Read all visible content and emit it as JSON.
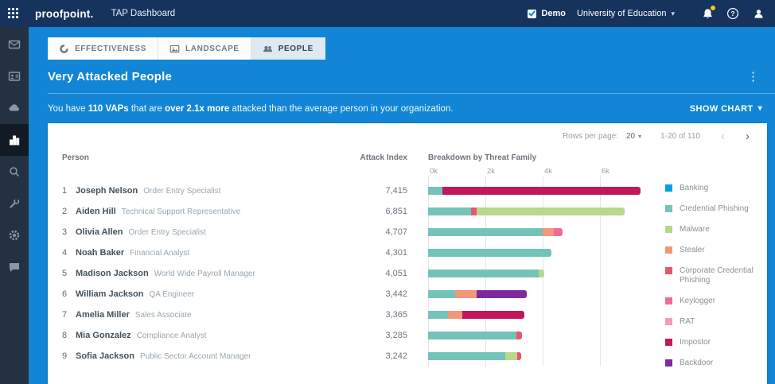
{
  "topbar": {
    "logo": "proofpoint.",
    "app_title": "TAP Dashboard",
    "demo_label": "Demo",
    "org_name": "University of Education"
  },
  "sidebar": {
    "items": [
      "mail",
      "contacts",
      "cloud",
      "analytics",
      "search",
      "tools",
      "settings",
      "chat"
    ],
    "active_item": "analytics"
  },
  "tabs": [
    {
      "label": "EFFECTIVENESS"
    },
    {
      "label": "LANDSCAPE"
    },
    {
      "label": "PEOPLE",
      "active": true
    }
  ],
  "panel": {
    "title": "Very Attacked People",
    "banner": {
      "prefix": "You have ",
      "vaps": "110 VAPs",
      "mid": " that are ",
      "emph": "over 2.1x more",
      "suffix": " attacked than the average person in your organization.",
      "show_chart_label": "SHOW CHART"
    },
    "pagination": {
      "rows_per_page_label": "Rows per page:",
      "rows_per_page_value": "20",
      "range": "1-20 of 110",
      "prev": "‹",
      "next": "›"
    }
  },
  "table": {
    "columns": [
      "Person",
      "Attack Index",
      "Breakdown by Threat Family"
    ]
  },
  "chart_data": {
    "type": "bar",
    "orientation": "horizontal-stacked",
    "title": "Breakdown by Threat Family",
    "axis_ticks": [
      "0k",
      "2k",
      "4k",
      "6k"
    ],
    "axis_max": 8000,
    "grid": true,
    "legend_position": "right",
    "legend": [
      {
        "label": "Banking",
        "color": "#00a3d9"
      },
      {
        "label": "Credential Phishing",
        "color": "#74c3bb"
      },
      {
        "label": "Malware",
        "color": "#b7d98b"
      },
      {
        "label": "Stealer",
        "color": "#f2977a"
      },
      {
        "label": "Corporate Credential Phishing",
        "color": "#e8566d"
      },
      {
        "label": "Keylogger",
        "color": "#f06a9a"
      },
      {
        "label": "RAT",
        "color": "#f49ac1"
      },
      {
        "label": "Impostor",
        "color": "#c2185b"
      },
      {
        "label": "Backdoor",
        "color": "#7c2a9e"
      }
    ],
    "rows": [
      {
        "rank": "1",
        "name": "Joseph Nelson",
        "role": "Order Entry Specialist",
        "attack_index": "7,415",
        "segments": [
          {
            "family": "Credential Phishing",
            "value": 500
          },
          {
            "family": "Impostor",
            "value": 6915
          }
        ]
      },
      {
        "rank": "2",
        "name": "Aiden Hill",
        "role": "Technical Support Representative",
        "attack_index": "6,851",
        "segments": [
          {
            "family": "Credential Phishing",
            "value": 1500
          },
          {
            "family": "Corporate Credential Phishing",
            "value": 200
          },
          {
            "family": "Malware",
            "value": 5151
          }
        ]
      },
      {
        "rank": "3",
        "name": "Olivia Allen",
        "role": "Order Entry Specialist",
        "attack_index": "4,707",
        "segments": [
          {
            "family": "Credential Phishing",
            "value": 4000
          },
          {
            "family": "Stealer",
            "value": 400
          },
          {
            "family": "Keylogger",
            "value": 307
          }
        ]
      },
      {
        "rank": "4",
        "name": "Noah Baker",
        "role": "Financial Analyst",
        "attack_index": "4,301",
        "segments": [
          {
            "family": "Credential Phishing",
            "value": 4301
          }
        ]
      },
      {
        "rank": "5",
        "name": "Madison Jackson",
        "role": "World Wide Payroll Manager",
        "attack_index": "4,051",
        "segments": [
          {
            "family": "Credential Phishing",
            "value": 3850
          },
          {
            "family": "Malware",
            "value": 201
          }
        ]
      },
      {
        "rank": "6",
        "name": "William Jackson",
        "role": "QA Engineer",
        "attack_index": "3,442",
        "segments": [
          {
            "family": "Credential Phishing",
            "value": 950
          },
          {
            "family": "Stealer",
            "value": 750
          },
          {
            "family": "Backdoor",
            "value": 1742
          }
        ]
      },
      {
        "rank": "7",
        "name": "Amelia Miller",
        "role": "Sales Associate",
        "attack_index": "3,365",
        "segments": [
          {
            "family": "Credential Phishing",
            "value": 700
          },
          {
            "family": "Stealer",
            "value": 500
          },
          {
            "family": "Impostor",
            "value": 2165
          }
        ]
      },
      {
        "rank": "8",
        "name": "Mia Gonzalez",
        "role": "Compliance Analyst",
        "attack_index": "3,285",
        "segments": [
          {
            "family": "Credential Phishing",
            "value": 3085
          },
          {
            "family": "Corporate Credential Phishing",
            "value": 200
          }
        ]
      },
      {
        "rank": "9",
        "name": "Sofia Jackson",
        "role": "Public Sector Account Manager",
        "attack_index": "3,242",
        "segments": [
          {
            "family": "Credential Phishing",
            "value": 2700
          },
          {
            "family": "Malware",
            "value": 400
          },
          {
            "family": "Corporate Credential Phishing",
            "value": 142
          }
        ]
      }
    ]
  },
  "colors": {
    "topbar": "#16335e",
    "sidebar": "#243140",
    "accent_blue": "#1285d6",
    "notification_badge": "#f8c525"
  }
}
